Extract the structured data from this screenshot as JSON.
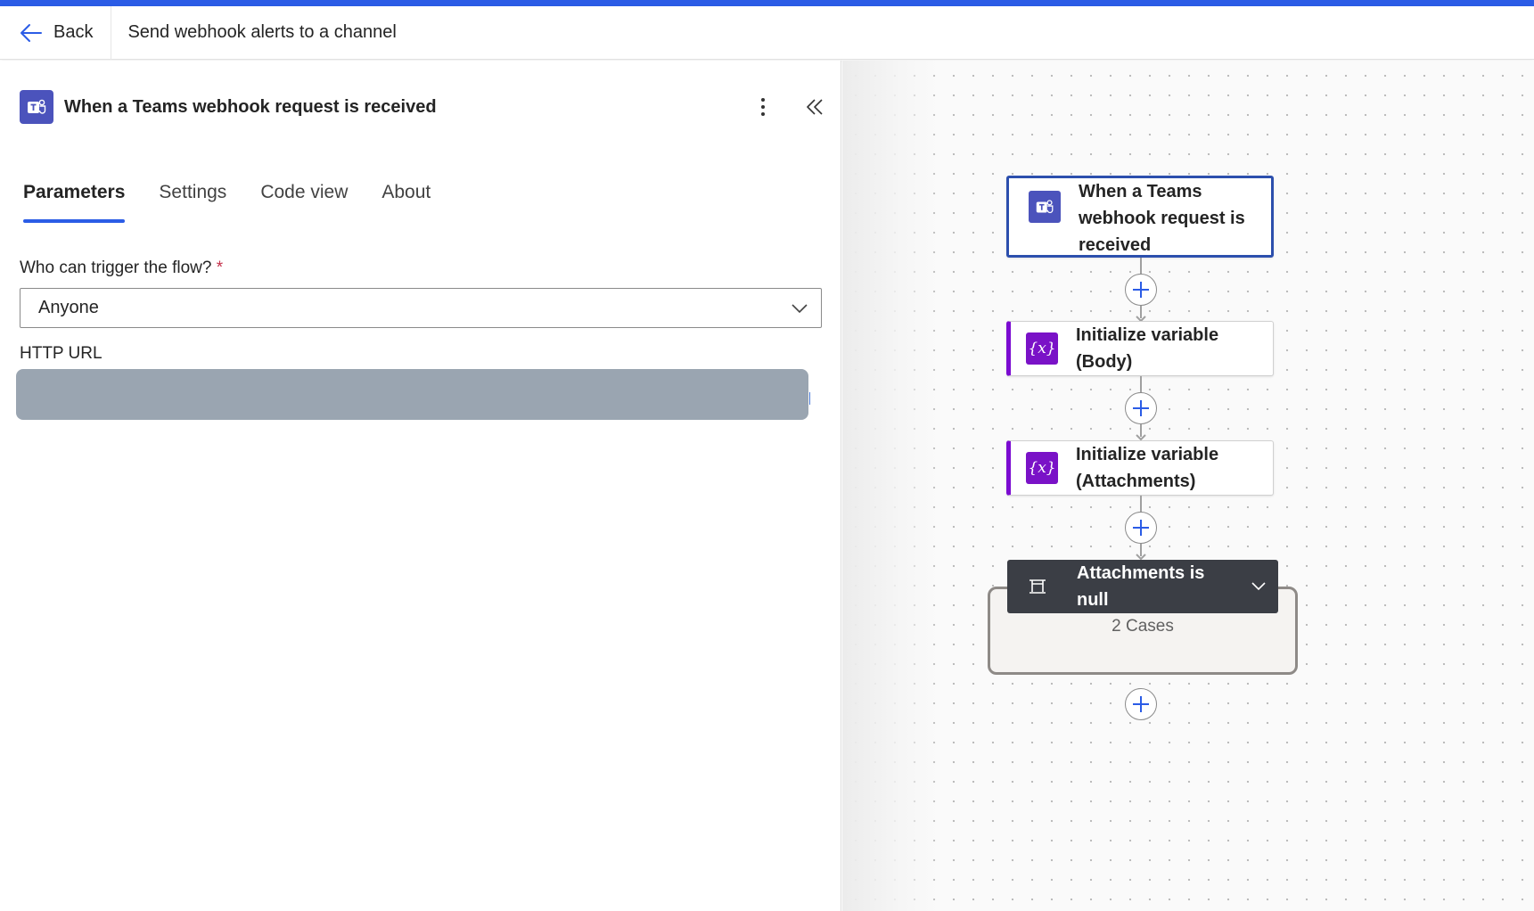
{
  "header": {
    "back_label": "Back",
    "flow_title": "Send webhook alerts to a channel"
  },
  "panel": {
    "title": "When a Teams webhook request is received",
    "tabs": [
      {
        "label": "Parameters",
        "active": true
      },
      {
        "label": "Settings",
        "active": false
      },
      {
        "label": "Code view",
        "active": false
      },
      {
        "label": "About",
        "active": false
      }
    ],
    "trigger_field": {
      "label": "Who can trigger the flow?",
      "required_mark": "*",
      "value": "Anyone"
    },
    "url_field": {
      "label": "HTTP URL",
      "value_redacted": true
    }
  },
  "canvas": {
    "nodes": [
      {
        "label": "When a Teams webhook request is received",
        "icon": "teams-icon",
        "selected": true
      },
      {
        "label": "Initialize variable (Body)",
        "icon": "variable-icon"
      },
      {
        "label": "Initialize variable (Attachments)",
        "icon": "variable-icon"
      }
    ],
    "switch": {
      "label": "Attachments is null",
      "icon": "switch-icon",
      "cases_label": "2 Cases"
    }
  },
  "colors": {
    "accent": "#2b5ce6",
    "teams_purple": "#4b53bc",
    "variable_purple": "#7a12c7",
    "switch_header": "#3b3e45"
  }
}
